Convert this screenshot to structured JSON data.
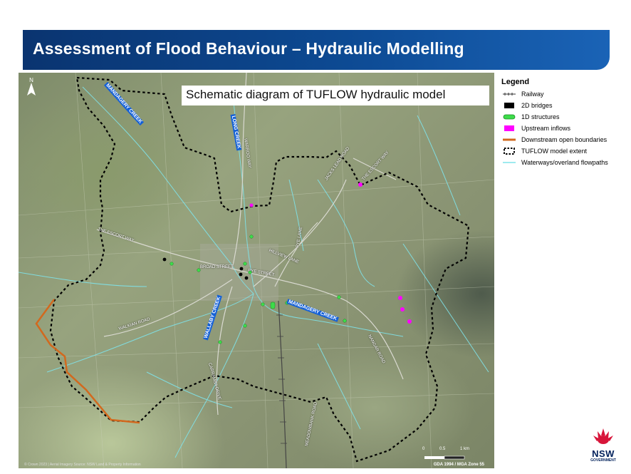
{
  "header": {
    "title": "Assessment of Flood Behaviour – Hydraulic Modelling"
  },
  "map": {
    "title": "Schematic diagram of TUFLOW hydraulic model",
    "north_label": "N",
    "roads": {
      "warroo_way": "WARROO WAY",
      "jacks_lead": "JACKS LEAD ROAD",
      "escort_way_ne": "THE ESCORT WAY",
      "escort_way_w": "THE ESCORT WAY",
      "pye_lane": "PYE LANE",
      "hillview_lane": "HILLVIEW LANE",
      "broad_street": "BROAD STREET",
      "pye_street": "PYE STREET",
      "walkian_road": "WALKIAN ROAD",
      "nangar_road": "NANGAR ROAD",
      "caranmba_drive": "CARRAMBA DRIVE",
      "meadowbank_road": "MEADOWBANK ROAD"
    },
    "creeks": {
      "mandagery": "MANDAGERY CREEK",
      "long_creek": "LONG CREEK",
      "wallaby": "WALLABY CREEK",
      "mandagery_s": "MANDAGERY CREEK"
    },
    "scale": {
      "zero": "0",
      "half": "0.5",
      "one": "1 km"
    },
    "credit": "© Crown 2023 | Aerial Imagery Source: NSW Land & Property Information",
    "projection": "GDA 1994 / MGA Zone 55"
  },
  "legend": {
    "title": "Legend",
    "items": [
      {
        "label": "Railway",
        "symbol": "railway"
      },
      {
        "label": "2D bridges",
        "symbol": "bridge",
        "color": "#000000"
      },
      {
        "label": "1D structures",
        "symbol": "structure",
        "color": "#3ddc4a"
      },
      {
        "label": "Upstream inflows",
        "symbol": "inflow",
        "color": "#ff00ff"
      },
      {
        "label": "Downstream open boundaries",
        "symbol": "boundary",
        "color": "#d2691e"
      },
      {
        "label": "TUFLOW model extent",
        "symbol": "extent",
        "color": "#000000"
      },
      {
        "label": "Waterways/overland flowpaths",
        "symbol": "waterway",
        "color": "#7fe3ea"
      }
    ]
  },
  "logo": {
    "name": "NSW",
    "sub": "GOVERNMENT"
  }
}
